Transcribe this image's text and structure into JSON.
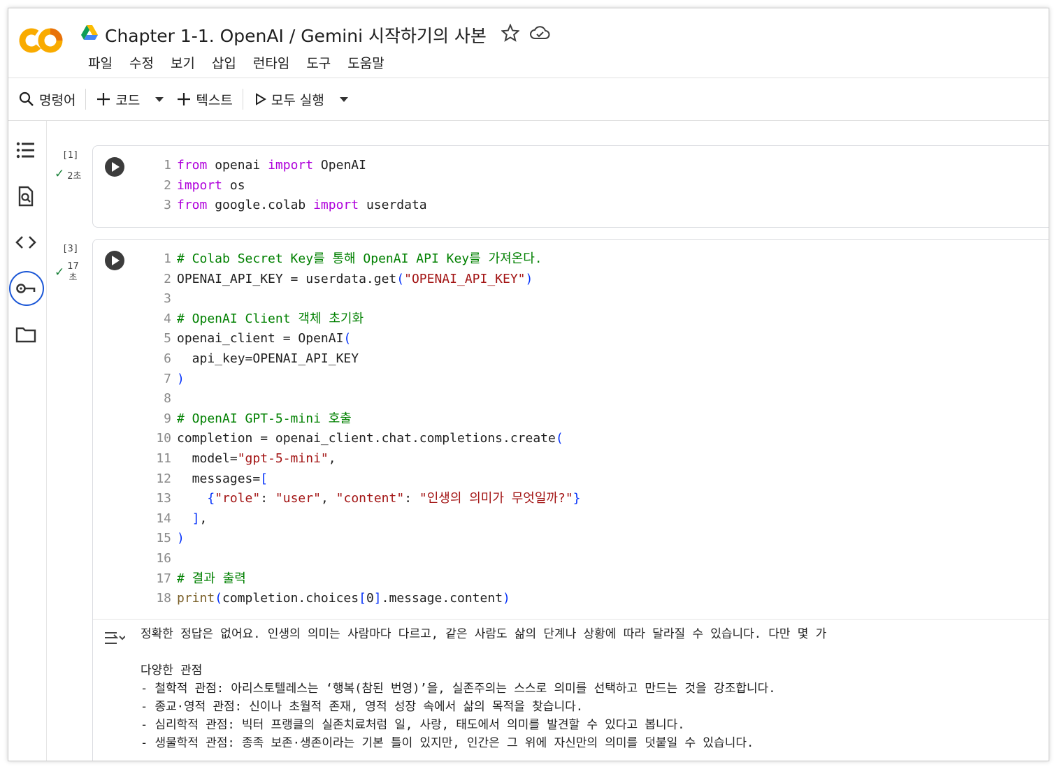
{
  "header": {
    "title": "Chapter 1-1. OpenAI / Gemini 시작하기의 사본",
    "logo_text": "CO",
    "menu": [
      "파일",
      "수정",
      "보기",
      "삽입",
      "런타임",
      "도구",
      "도움말"
    ]
  },
  "toolbar": {
    "commands_label": "명령어",
    "code_label": "코드",
    "text_label": "텍스트",
    "run_all_label": "모두 실행"
  },
  "colors": {
    "accent": "#1a56d6",
    "logo_orange": "#f9ab00",
    "logo_dark": "#e8710a",
    "check": "#188038"
  },
  "cells": [
    {
      "exec_count": "[1]",
      "duration": "2초"
    },
    {
      "exec_count": "[3]",
      "duration": "17\n초"
    }
  ],
  "output": {
    "lines": [
      "정확한 정답은 없어요. 인생의 의미는 사람마다 다르고, 같은 사람도 삶의 단계나 상황에 따라 달라질 수 있습니다. 다만 몇 가",
      "",
      "다양한 관점",
      "- 철학적 관점: 아리스토텔레스는 ‘행복(참된 번영)’을, 실존주의는 스스로 의미를 선택하고 만드는 것을 강조합니다.",
      "- 종교·영적 관점: 신이나 초월적 존재, 영적 성장 속에서 삶의 목적을 찾습니다.",
      "- 심리학적 관점: 빅터 프랭클의 실존치료처럼 일, 사랑, 태도에서 의미를 발견할 수 있다고 봅니다.",
      "- 생물학적 관점: 종족 보존·생존이라는 기본 틀이 있지만, 인간은 그 위에 자신만의 의미를 덧붙일 수 있습니다."
    ]
  }
}
